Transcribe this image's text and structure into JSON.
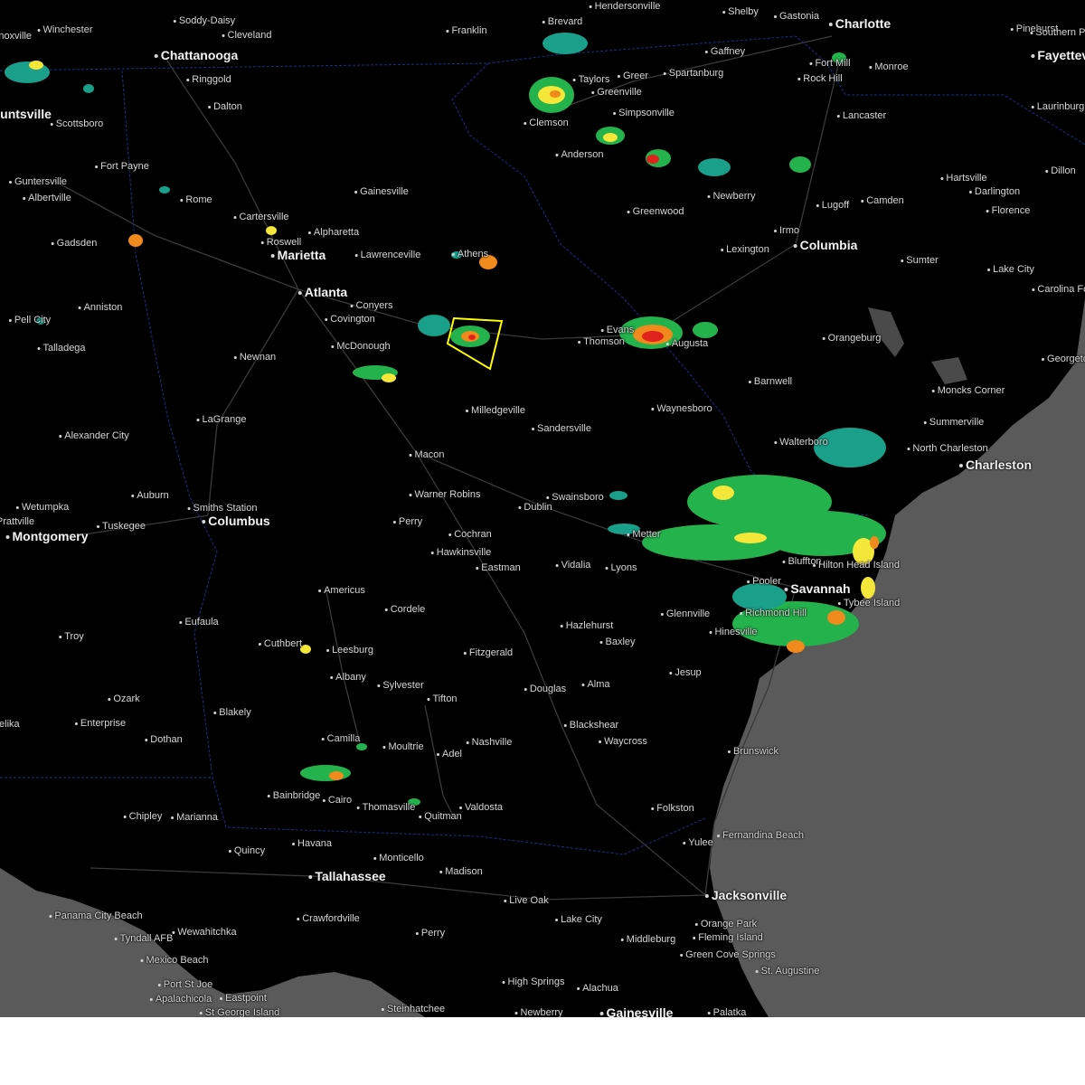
{
  "map": {
    "background": "#000000",
    "water": "#5a5a5a",
    "water_inland": "#4a4a4a",
    "roads": "#3a3a3a",
    "state_border": "#1b2f8a",
    "warning_polygon_color": "#ffff00",
    "radar_colors": {
      "light": "#1a9f8a",
      "green": "#23b24b",
      "yellow": "#f5e63a",
      "orange": "#f08a1c",
      "red": "#e0231c"
    }
  },
  "cities": [
    {
      "name": "Knoxville",
      "major": false
    },
    {
      "name": "Soddy-Daisy",
      "major": false
    },
    {
      "name": "Cleveland",
      "major": false
    },
    {
      "name": "Winchester",
      "major": false
    },
    {
      "name": "Chattanooga",
      "major": true
    },
    {
      "name": "Ringgold",
      "major": false
    },
    {
      "name": "Dalton",
      "major": false
    },
    {
      "name": "Scottsboro",
      "major": false
    },
    {
      "name": "Huntsville",
      "major": true
    },
    {
      "name": "Fort Payne",
      "major": false
    },
    {
      "name": "Guntersville",
      "major": false
    },
    {
      "name": "Albertville",
      "major": false
    },
    {
      "name": "Rome",
      "major": false
    },
    {
      "name": "Cartersville",
      "major": false
    },
    {
      "name": "Gadsden",
      "major": false
    },
    {
      "name": "Roswell",
      "major": false
    },
    {
      "name": "Alpharetta",
      "major": false
    },
    {
      "name": "Marietta",
      "major": true
    },
    {
      "name": "Gainesville",
      "major": false
    },
    {
      "name": "Lawrenceville",
      "major": false
    },
    {
      "name": "Athens",
      "major": false
    },
    {
      "name": "Atlanta",
      "major": true
    },
    {
      "name": "Conyers",
      "major": false
    },
    {
      "name": "Covington",
      "major": false
    },
    {
      "name": "Anniston",
      "major": false
    },
    {
      "name": "Pell City",
      "major": false
    },
    {
      "name": "Talladega",
      "major": false
    },
    {
      "name": "McDonough",
      "major": false
    },
    {
      "name": "Newnan",
      "major": false
    },
    {
      "name": "LaGrange",
      "major": false
    },
    {
      "name": "Milledgeville",
      "major": false
    },
    {
      "name": "Macon",
      "major": false
    },
    {
      "name": "Alexander City",
      "major": false
    },
    {
      "name": "Wetumpka",
      "major": false
    },
    {
      "name": "Auburn",
      "major": false
    },
    {
      "name": "Smiths Station",
      "major": false
    },
    {
      "name": "Columbus",
      "major": true
    },
    {
      "name": "Prattville",
      "major": false
    },
    {
      "name": "Montgomery",
      "major": true
    },
    {
      "name": "Tuskegee",
      "major": false
    },
    {
      "name": "Warner Robins",
      "major": false
    },
    {
      "name": "Perry",
      "major": false
    },
    {
      "name": "Cochran",
      "major": false
    },
    {
      "name": "Hawkinsville",
      "major": false
    },
    {
      "name": "Eastman",
      "major": false
    },
    {
      "name": "Dublin",
      "major": false
    },
    {
      "name": "Swainsboro",
      "major": false
    },
    {
      "name": "Sandersville",
      "major": false
    },
    {
      "name": "Waynesboro",
      "major": false
    },
    {
      "name": "Thomson",
      "major": false
    },
    {
      "name": "Evans",
      "major": false
    },
    {
      "name": "Augusta",
      "major": false
    },
    {
      "name": "Barnwell",
      "major": false
    },
    {
      "name": "Orangeburg",
      "major": false
    },
    {
      "name": "Walterboro",
      "major": false
    },
    {
      "name": "Summerville",
      "major": false
    },
    {
      "name": "North Charleston",
      "major": false
    },
    {
      "name": "Charleston",
      "major": true
    },
    {
      "name": "Moncks Corner",
      "major": false
    },
    {
      "name": "Georgetown",
      "major": false
    },
    {
      "name": "Columbia",
      "major": true
    },
    {
      "name": "Irmo",
      "major": false
    },
    {
      "name": "Lexington",
      "major": false
    },
    {
      "name": "Sumter",
      "major": false
    },
    {
      "name": "Lake City",
      "major": false
    },
    {
      "name": "Carolina Forest",
      "major": false
    },
    {
      "name": "Florence",
      "major": false
    },
    {
      "name": "Darlington",
      "major": false
    },
    {
      "name": "Hartsville",
      "major": false
    },
    {
      "name": "Dillon",
      "major": false
    },
    {
      "name": "Laurinburg",
      "major": false
    },
    {
      "name": "Camden",
      "major": false
    },
    {
      "name": "Lugoff",
      "major": false
    },
    {
      "name": "Lancaster",
      "major": false
    },
    {
      "name": "Rock Hill",
      "major": false
    },
    {
      "name": "Fort Mill",
      "major": false
    },
    {
      "name": "Monroe",
      "major": false
    },
    {
      "name": "Charlotte",
      "major": true
    },
    {
      "name": "Gastonia",
      "major": false
    },
    {
      "name": "Shelby",
      "major": false
    },
    {
      "name": "Pinehurst",
      "major": false
    },
    {
      "name": "Southern Pines",
      "major": false
    },
    {
      "name": "Fayetteville",
      "major": true
    },
    {
      "name": "Gaffney",
      "major": false
    },
    {
      "name": "Spartanburg",
      "major": false
    },
    {
      "name": "Greer",
      "major": false
    },
    {
      "name": "Taylors",
      "major": false
    },
    {
      "name": "Greenville",
      "major": false
    },
    {
      "name": "Simpsonville",
      "major": false
    },
    {
      "name": "Clemson",
      "major": false
    },
    {
      "name": "Anderson",
      "major": false
    },
    {
      "name": "Newberry",
      "major": false
    },
    {
      "name": "Greenwood",
      "major": false
    },
    {
      "name": "Hendersonville",
      "major": false
    },
    {
      "name": "Brevard",
      "major": false
    },
    {
      "name": "Franklin",
      "major": false
    },
    {
      "name": "Bluffton",
      "major": false
    },
    {
      "name": "Hilton Head Island",
      "major": false
    },
    {
      "name": "Savannah",
      "major": true
    },
    {
      "name": "Pooler",
      "major": false
    },
    {
      "name": "Tybee Island",
      "major": false
    },
    {
      "name": "Richmond Hill",
      "major": false
    },
    {
      "name": "Hinesville",
      "major": false
    },
    {
      "name": "Glennville",
      "major": false
    },
    {
      "name": "Vidalia",
      "major": false
    },
    {
      "name": "Lyons",
      "major": false
    },
    {
      "name": "Metter",
      "major": false
    },
    {
      "name": "Hazlehurst",
      "major": false
    },
    {
      "name": "Baxley",
      "major": false
    },
    {
      "name": "Jesup",
      "major": false
    },
    {
      "name": "Alma",
      "major": false
    },
    {
      "name": "Douglas",
      "major": false
    },
    {
      "name": "Fitzgerald",
      "major": false
    },
    {
      "name": "Tifton",
      "major": false
    },
    {
      "name": "Sylvester",
      "major": false
    },
    {
      "name": "Albany",
      "major": false
    },
    {
      "name": "Leesburg",
      "major": false
    },
    {
      "name": "Americus",
      "major": false
    },
    {
      "name": "Cordele",
      "major": false
    },
    {
      "name": "Cuthbert",
      "major": false
    },
    {
      "name": "Eufaula",
      "major": false
    },
    {
      "name": "Troy",
      "major": false
    },
    {
      "name": "Ozark",
      "major": false
    },
    {
      "name": "Enterprise",
      "major": false
    },
    {
      "name": "Opelika",
      "major": false
    },
    {
      "name": "Dothan",
      "major": false
    },
    {
      "name": "Blakely",
      "major": false
    },
    {
      "name": "Camilla",
      "major": false
    },
    {
      "name": "Moultrie",
      "major": false
    },
    {
      "name": "Adel",
      "major": false
    },
    {
      "name": "Nashville",
      "major": false
    },
    {
      "name": "Blackshear",
      "major": false
    },
    {
      "name": "Waycross",
      "major": false
    },
    {
      "name": "Brunswick",
      "major": false
    },
    {
      "name": "Bainbridge",
      "major": false
    },
    {
      "name": "Cairo",
      "major": false
    },
    {
      "name": "Thomasville",
      "major": false
    },
    {
      "name": "Quitman",
      "major": false
    },
    {
      "name": "Valdosta",
      "major": false
    },
    {
      "name": "Folkston",
      "major": false
    },
    {
      "name": "Fernandina Beach",
      "major": false
    },
    {
      "name": "Yulee",
      "major": false
    },
    {
      "name": "Chipley",
      "major": false
    },
    {
      "name": "Marianna",
      "major": false
    },
    {
      "name": "Quincy",
      "major": false
    },
    {
      "name": "Havana",
      "major": false
    },
    {
      "name": "Tallahassee",
      "major": true
    },
    {
      "name": "Monticello",
      "major": false
    },
    {
      "name": "Madison",
      "major": false
    },
    {
      "name": "Live Oak",
      "major": false
    },
    {
      "name": "Lake City",
      "major": false
    },
    {
      "name": "Jacksonville",
      "major": true
    },
    {
      "name": "Orange Park",
      "major": false
    },
    {
      "name": "Fleming Island",
      "major": false
    },
    {
      "name": "Green Cove Springs",
      "major": false
    },
    {
      "name": "Middleburg",
      "major": false
    },
    {
      "name": "St. Augustine",
      "major": false
    },
    {
      "name": "Crawfordville",
      "major": false
    },
    {
      "name": "Perry",
      "major": false
    },
    {
      "name": "Panama City Beach",
      "major": false
    },
    {
      "name": "Tyndall AFB",
      "major": false
    },
    {
      "name": "Wewahitchka",
      "major": false
    },
    {
      "name": "Mexico Beach",
      "major": false
    },
    {
      "name": "Port St Joe",
      "major": false
    },
    {
      "name": "Apalachicola",
      "major": false
    },
    {
      "name": "Eastpoint",
      "major": false
    },
    {
      "name": "St George Island",
      "major": false
    },
    {
      "name": "High Springs",
      "major": false
    },
    {
      "name": "Alachua",
      "major": false
    },
    {
      "name": "Steinhatchee",
      "major": false
    },
    {
      "name": "Newberry",
      "major": false
    },
    {
      "name": "Gainesville",
      "major": true
    },
    {
      "name": "Palatka",
      "major": false
    }
  ]
}
